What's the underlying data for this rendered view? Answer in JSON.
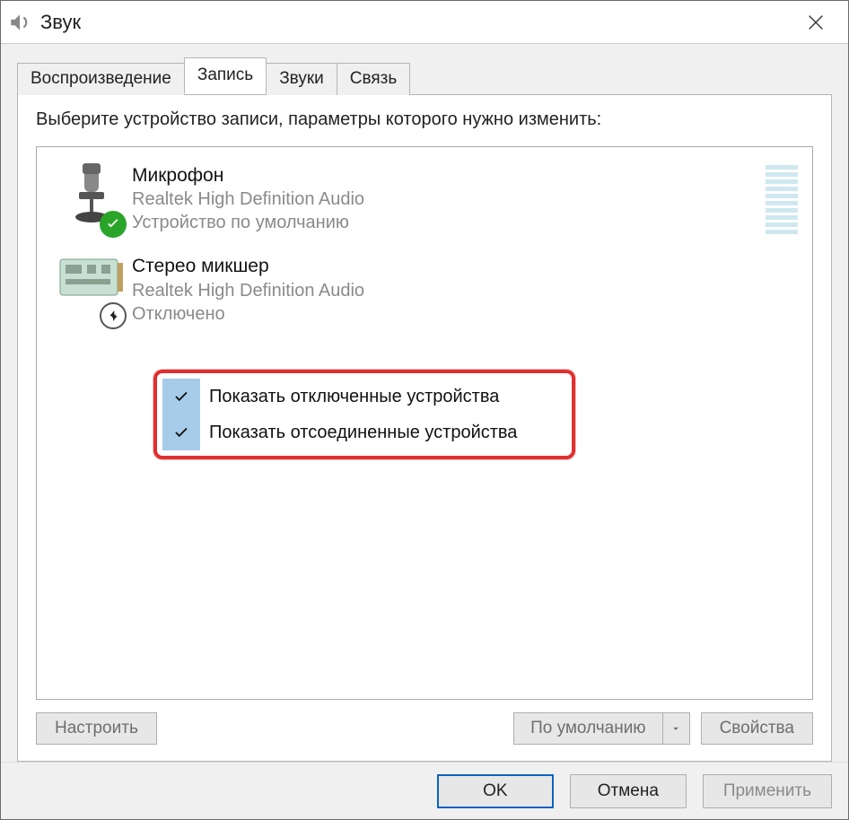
{
  "window": {
    "title": "Звук"
  },
  "tabs": [
    {
      "label": "Воспроизведение"
    },
    {
      "label": "Запись"
    },
    {
      "label": "Звуки"
    },
    {
      "label": "Связь"
    }
  ],
  "instruction": "Выберите устройство записи, параметры которого нужно изменить:",
  "devices": [
    {
      "name": "Микрофон",
      "driver": "Realtek High Definition Audio",
      "status": "Устройство по умолчанию"
    },
    {
      "name": "Стерео микшер",
      "driver": "Realtek High Definition Audio",
      "status": "Отключено"
    }
  ],
  "context_menu": {
    "items": [
      {
        "label": "Показать отключенные устройства",
        "checked": true
      },
      {
        "label": "Показать отсоединенные устройства",
        "checked": true
      }
    ]
  },
  "panel_buttons": {
    "configure": "Настроить",
    "default": "По умолчанию",
    "properties": "Свойства"
  },
  "dialog_buttons": {
    "ok": "OK",
    "cancel": "Отмена",
    "apply": "Применить"
  }
}
